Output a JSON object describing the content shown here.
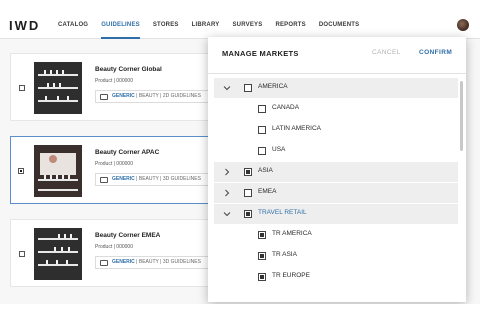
{
  "app": {
    "logo": "IWD"
  },
  "nav": {
    "items": [
      {
        "label": "CATALOG"
      },
      {
        "label": "GUIDELINES"
      },
      {
        "label": "STORES"
      },
      {
        "label": "LIBRARY"
      },
      {
        "label": "SURVEYS"
      },
      {
        "label": "REPORTS"
      },
      {
        "label": "DOCUMENTS"
      }
    ],
    "active": "GUIDELINES"
  },
  "cards": [
    {
      "title": "Beauty Corner Global",
      "subtitle": "Product | 000000",
      "tag_generic": "GENERIC",
      "tag_path": " | BEAUTY | 2D GUIDELINES",
      "checked": false
    },
    {
      "title": "Beauty Corner APAC",
      "subtitle": "Product | 000000",
      "tag_generic": "GENERIC",
      "tag_path": " | BEAUTY | 3D GUIDELINES",
      "checked": true
    },
    {
      "title": "Beauty Corner EMEA",
      "subtitle": "Product | 000000",
      "tag_generic": "GENERIC",
      "tag_path": " | BEAUTY | 3D GUIDELINES",
      "checked": false
    }
  ],
  "modal": {
    "title": "MANAGE MARKETS",
    "cancel_label": "CANCEL",
    "confirm_label": "CONFIRM",
    "rows": [
      {
        "label": "AMERICA",
        "level": 0,
        "expanded": true,
        "checked": false
      },
      {
        "label": "CANADA",
        "level": 1,
        "checked": false
      },
      {
        "label": "LATIN AMERICA",
        "level": 1,
        "checked": false
      },
      {
        "label": "USA",
        "level": 1,
        "checked": false
      },
      {
        "label": "ASIA",
        "level": 0,
        "expanded": false,
        "checked": true
      },
      {
        "label": "EMEA",
        "level": 0,
        "expanded": false,
        "checked": false
      },
      {
        "label": "TRAVEL RETAIL",
        "level": 0,
        "expanded": true,
        "checked": true
      },
      {
        "label": "TR AMERICA",
        "level": 1,
        "checked": true
      },
      {
        "label": "TR ASIA",
        "level": 1,
        "checked": true
      },
      {
        "label": "TR EUROPE",
        "level": 1,
        "checked": true
      }
    ]
  },
  "colors": {
    "accent": "#2f6fa8",
    "muted": "#b0b0b0",
    "row_shade": "#eeeeee"
  }
}
